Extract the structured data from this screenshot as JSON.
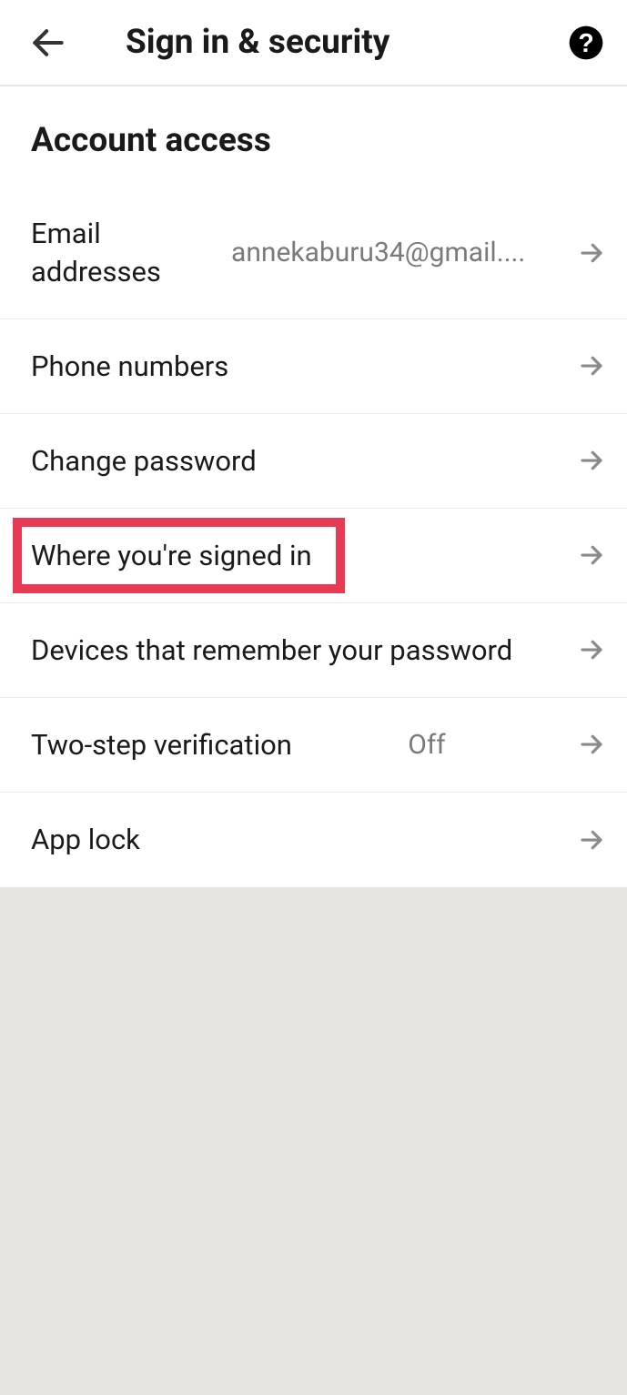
{
  "header": {
    "title": "Sign in & security"
  },
  "section": {
    "title": "Account access"
  },
  "rows": {
    "email": {
      "label": "Email addresses",
      "value": "annekaburu34@gmail...."
    },
    "phone": {
      "label": "Phone numbers"
    },
    "changepw": {
      "label": "Change password"
    },
    "signedin": {
      "label": "Where you're signed in"
    },
    "devices": {
      "label": "Devices that remember your password"
    },
    "twostep": {
      "label": "Two-step verification",
      "value": "Off"
    },
    "applock": {
      "label": "App lock"
    }
  }
}
